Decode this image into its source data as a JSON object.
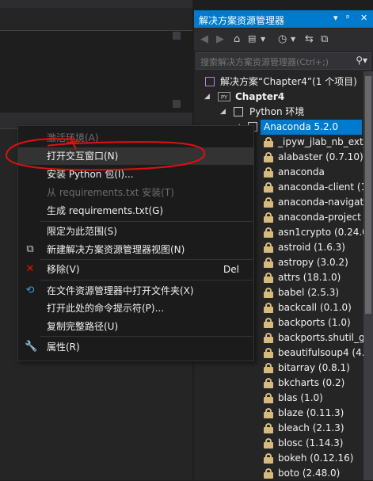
{
  "explorer": {
    "title": "解决方案资源管理器",
    "title_buttons": [
      "▾",
      "ᵖ",
      "✕"
    ],
    "search_placeholder": "搜索解决方案资源管理器(Ctrl+;)",
    "tree": [
      {
        "label": "解决方案“Chapter4”(1 个项目)",
        "level": 0,
        "icon": "solution-icon",
        "arrow": ""
      },
      {
        "label": "Chapter4",
        "level": 1,
        "icon": "python-project-icon",
        "arrow": "◢",
        "bold": true
      },
      {
        "label": "Python 环境",
        "level": 2,
        "icon": "environment-icon",
        "arrow": "◢"
      },
      {
        "label": "Anaconda 5.2.0",
        "level": 3,
        "icon": "environment-icon",
        "arrow": "◢",
        "selected": true
      }
    ],
    "packages": [
      "_ipyw_jlab_nb_ext_",
      "alabaster (0.7.10)",
      "anaconda",
      "anaconda-client (1",
      "anaconda-navigat",
      "anaconda-project",
      "asn1crypto (0.24.0",
      "astroid (1.6.3)",
      "astropy (3.0.2)",
      "attrs (18.1.0)",
      "babel (2.5.3)",
      "backcall (0.1.0)",
      "backports (1.0)",
      "backports.shutil_g",
      "beautifulsoup4 (4.",
      "bitarray (0.8.1)",
      "bkcharts (0.2)",
      "blas (1.0)",
      "blaze (0.11.3)",
      "bleach (2.1.3)",
      "blosc (1.14.3)",
      "bokeh (0.12.16)",
      "boto (2.48.0)"
    ]
  },
  "context_menu": {
    "items": [
      {
        "type": "item",
        "label": "激活环境(A)",
        "disabled": true,
        "icon": ""
      },
      {
        "type": "item",
        "label": "打开交互窗口(N)",
        "highlight": true,
        "icon": ""
      },
      {
        "type": "item",
        "label": "安装 Python 包(I)...",
        "icon": ""
      },
      {
        "type": "item",
        "label": "从 requirements.txt 安装(T)",
        "disabled": true,
        "icon": ""
      },
      {
        "type": "item",
        "label": "生成 requirements.txt(G)",
        "icon": ""
      },
      {
        "type": "sep"
      },
      {
        "type": "item",
        "label": "限定为此范围(S)",
        "icon": ""
      },
      {
        "type": "item",
        "label": "新建解决方案资源管理器视图(N)",
        "icon": "new-view-icon"
      },
      {
        "type": "sep"
      },
      {
        "type": "item",
        "label": "移除(V)",
        "shortcut": "Del",
        "icon": "remove-icon"
      },
      {
        "type": "sep"
      },
      {
        "type": "item",
        "label": "在文件资源管理器中打开文件夹(X)",
        "icon": "refresh-icon"
      },
      {
        "type": "item",
        "label": "打开此处的命令提示符(P)...",
        "icon": ""
      },
      {
        "type": "item",
        "label": "复制完整路径(U)",
        "icon": ""
      },
      {
        "type": "sep"
      },
      {
        "type": "item",
        "label": "属性(R)",
        "icon": "wrench-icon"
      }
    ]
  },
  "colors": {
    "accent": "#007acc",
    "package_icon": "#d7ba7d",
    "remove_icon": "#e51400",
    "annotation": "#e01010"
  }
}
